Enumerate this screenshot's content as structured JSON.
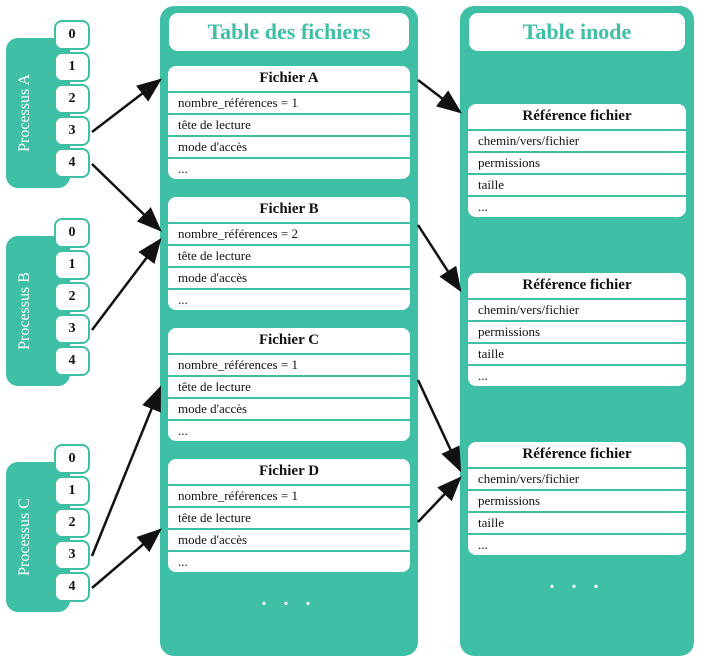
{
  "processes": [
    {
      "label": "Processus A",
      "fds": [
        "0",
        "1",
        "2",
        "3",
        "4"
      ]
    },
    {
      "label": "Processus B",
      "fds": [
        "0",
        "1",
        "2",
        "3",
        "4"
      ]
    },
    {
      "label": "Processus C",
      "fds": [
        "0",
        "1",
        "2",
        "3",
        "4"
      ]
    }
  ],
  "file_table": {
    "title": "Table des fichiers",
    "files": [
      {
        "name": "Fichier A",
        "rows": [
          "nombre_références = 1",
          "tête de lecture",
          "mode d'accès",
          "..."
        ]
      },
      {
        "name": "Fichier B",
        "rows": [
          "nombre_références = 2",
          "tête de lecture",
          "mode d'accès",
          "..."
        ]
      },
      {
        "name": "Fichier C",
        "rows": [
          "nombre_références = 1",
          "tête de lecture",
          "mode d'accès",
          "..."
        ]
      },
      {
        "name": "Fichier D",
        "rows": [
          "nombre_références = 1",
          "tête de lecture",
          "mode d'accès",
          "..."
        ]
      }
    ],
    "footer": ". . ."
  },
  "inode_table": {
    "title": "Table inode",
    "entries": [
      {
        "name": "Référence fichier",
        "rows": [
          "chemin/vers/fichier",
          "permissions",
          "taille",
          "..."
        ]
      },
      {
        "name": "Référence fichier",
        "rows": [
          "chemin/vers/fichier",
          "permissions",
          "taille",
          "..."
        ]
      },
      {
        "name": "Référence fichier",
        "rows": [
          "chemin/vers/fichier",
          "permissions",
          "taille",
          "..."
        ]
      }
    ],
    "footer": ". . ."
  },
  "arrows": [
    {
      "from": "procA.fd3",
      "to": "FichierA"
    },
    {
      "from": "procA.fd4",
      "to": "FichierB"
    },
    {
      "from": "procB.fd3",
      "to": "FichierB"
    },
    {
      "from": "procC.fd3",
      "to": "FichierC"
    },
    {
      "from": "procC.fd4",
      "to": "FichierD"
    },
    {
      "from": "FichierA",
      "to": "inode0"
    },
    {
      "from": "FichierB",
      "to": "inode1"
    },
    {
      "from": "FichierC",
      "to": "inode2"
    },
    {
      "from": "FichierD",
      "to": "inode2"
    }
  ]
}
